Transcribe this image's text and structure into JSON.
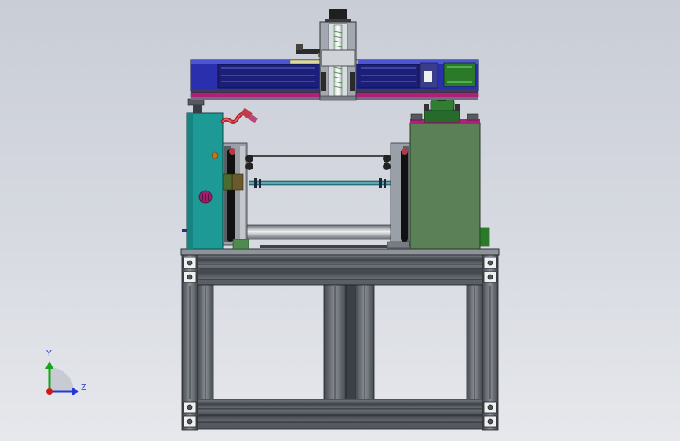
{
  "viewport": {
    "background_top": "#c9cdd6",
    "background_bottom": "#e6e8ec"
  },
  "triad": {
    "y_label": "Y",
    "z_label": "Z",
    "y_color": "#17a31c",
    "z_color": "#2338d6",
    "x_color": "#d01919"
  },
  "colors": {
    "gantry_blue": "#2a2fae",
    "rail_dark": "#3d3d55",
    "magenta_strip": "#b0207a",
    "left_housing_teal": "#1d9a95",
    "right_housing_green": "#5b7f57",
    "aluminum": "#5c6066",
    "aluminum_light": "#8e939a",
    "motor_green": "#2a7a2a",
    "shaft_teal": "#2c7d8c",
    "hose_red": "#b0232a"
  }
}
